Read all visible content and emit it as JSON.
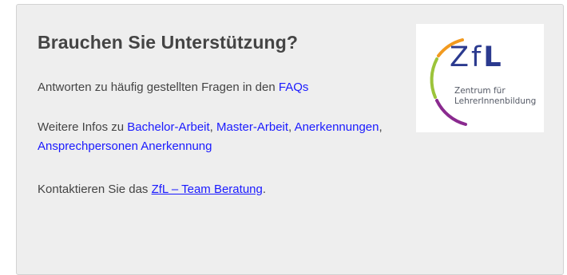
{
  "card": {
    "title": "Brauchen Sie Unterstützung?",
    "faq_text": "Antworten zu häufig gestellten Fragen in den ",
    "faq_link": "FAQs",
    "infos_text": "Weitere Infos zu ",
    "links": {
      "bachelor": "Bachelor-Arbeit",
      "master": "Master-Arbeit",
      "anerkennungen": "Anerkennungen",
      "ansprechpersonen": "Ansprechpersonen Anerkennung"
    },
    "separator": ", ",
    "contact_text": "Kontaktieren Sie das ",
    "contact_link": "ZfL – Team Beratung",
    "contact_end": "."
  },
  "logo": {
    "letters_zf": "Zf",
    "letter_l": "L",
    "line1": "Zentrum für",
    "line2": "LehrerInnenbildung",
    "colors": {
      "blue": "#2b3a8f",
      "green": "#9cc43a",
      "purple": "#8a2a8f",
      "orange": "#f29a1f"
    }
  },
  "colors": {
    "link": "#1a1aff",
    "text": "#444444",
    "card_bg": "#eeeeee"
  }
}
